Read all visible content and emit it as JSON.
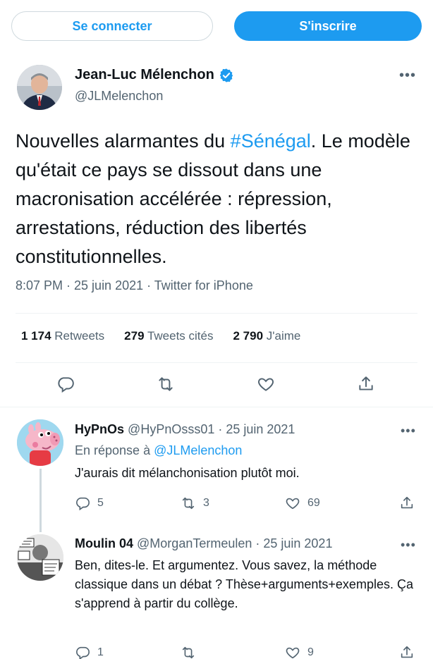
{
  "header": {
    "login_label": "Se connecter",
    "signup_label": "S'inscrire"
  },
  "tweet": {
    "author_name": "Jean-Luc Mélenchon",
    "author_handle": "@JLMelenchon",
    "text_before": "Nouvelles alarmantes du ",
    "hashtag": "#Sénégal",
    "text_after": ". Le modèle qu'était ce pays se dissout dans une macronisation accélérée : répression, arrestations, réduction des libertés constitutionnelles.",
    "meta": "8:07 PM · 25 juin 2021 · Twitter for iPhone",
    "retweets_count": "1 174",
    "retweets_label": "Retweets",
    "quotes_count": "279",
    "quotes_label": "Tweets cités",
    "likes_count": "2 790",
    "likes_label": "J'aime"
  },
  "replies": [
    {
      "name": "HyPnOs",
      "handle_date": "@HyPnOsss01 · 25 juin 2021",
      "reply_to_label": "En réponse à ",
      "reply_to_handle": "@JLMelenchon",
      "text": "J'aurais dit mélanchonisation plutôt moi.",
      "replies": "5",
      "retweets": "3",
      "likes": "69"
    },
    {
      "name": "Moulin 04",
      "handle_date": "@MorganTermeulen · 25 juin 2021",
      "text": "Ben, dites-le. Et argumentez. Vous savez, la méthode classique dans un débat ? Thèse+arguments+exemples. Ça s'apprend à partir du collège.",
      "replies": "1",
      "retweets": "",
      "likes": "9"
    }
  ],
  "icons": {
    "more": "more-icon",
    "verified": "verified-badge-icon",
    "reply": "reply-icon",
    "retweet": "retweet-icon",
    "like": "like-icon",
    "share": "share-icon"
  },
  "colors": {
    "accent": "#1d9bf0",
    "text": "#0f1419",
    "muted": "#536471",
    "border": "#eff3f4"
  }
}
